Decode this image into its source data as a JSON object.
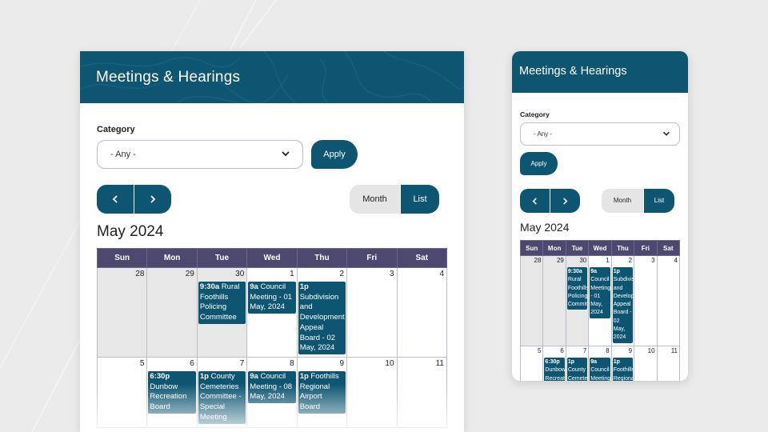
{
  "desktop": {
    "title": "Meetings & Hearings",
    "category_label": "Category",
    "select_value": "- Any -",
    "apply_label": "Apply",
    "prev_icon": "chevron-left-icon",
    "next_icon": "chevron-right-icon",
    "view_toggle": {
      "month": "Month",
      "list": "List"
    },
    "month_title": "May 2024"
  },
  "mobile": {
    "title": "Meetings & Hearings",
    "category_label": "Category",
    "select_value": "- Any -",
    "apply_label": "Apply",
    "view_toggle": {
      "month": "Month",
      "list": "List"
    },
    "month_title": "May 2024"
  },
  "calendar": {
    "weekdays": [
      "Sun",
      "Mon",
      "Tue",
      "Wed",
      "Thu",
      "Fri",
      "Sat"
    ],
    "weeks": [
      [
        {
          "day": "28",
          "outside": true
        },
        {
          "day": "29",
          "outside": true
        },
        {
          "day": "30",
          "outside": true,
          "event": {
            "time": "9:30a",
            "text": "Rural Foothills Policing Committee"
          }
        },
        {
          "day": "1",
          "event": {
            "time": "9a",
            "text": "Council Meeting - 01 May, 2024"
          }
        },
        {
          "day": "2",
          "event": {
            "time": "1p",
            "text": "Subdivision and Development Appeal Board - 02 May, 2024"
          }
        },
        {
          "day": "3"
        },
        {
          "day": "4"
        }
      ],
      [
        {
          "day": "5"
        },
        {
          "day": "6",
          "event": {
            "time": "6:30p",
            "text": "Dunbow Recreation Board"
          }
        },
        {
          "day": "7",
          "event": {
            "time": "1p",
            "text": "County Cemeteries Committee - Special Meeting"
          }
        },
        {
          "day": "8",
          "event": {
            "time": "9a",
            "text": "Council Meeting - 08 May, 2024"
          }
        },
        {
          "day": "9",
          "event": {
            "time": "1p",
            "text": "Foothills Regional Airport Board"
          }
        },
        {
          "day": "10"
        },
        {
          "day": "11"
        }
      ]
    ]
  },
  "colors": {
    "brand": "#0e5572",
    "weekday_header": "#4c4870",
    "outside_day": "#e7e7e7",
    "background": "#ebebeb"
  }
}
